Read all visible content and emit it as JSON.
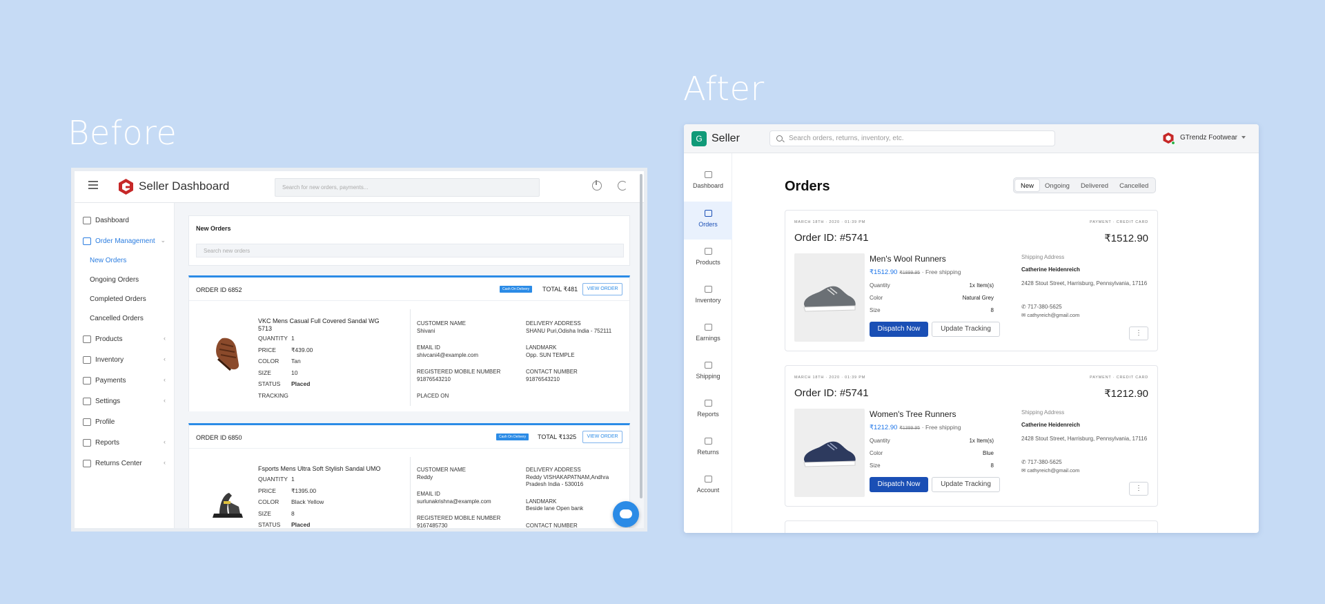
{
  "labels": {
    "before": "Before",
    "after": "After"
  },
  "before": {
    "app_title": "Seller Dashboard",
    "search_placeholder": "Search for new orders, payments...",
    "nav": [
      {
        "label": "Dashboard",
        "icon": "home-icon"
      },
      {
        "label": "Order Management",
        "icon": "cart-icon",
        "active": true
      },
      {
        "label": "Products",
        "icon": "list-icon"
      },
      {
        "label": "Inventory",
        "icon": "box-icon"
      },
      {
        "label": "Payments",
        "icon": "card-icon"
      },
      {
        "label": "Settings",
        "icon": "gear-icon"
      },
      {
        "label": "Profile",
        "icon": "user-icon"
      },
      {
        "label": "Reports",
        "icon": "clip-icon"
      },
      {
        "label": "Returns Center",
        "icon": "return-icon"
      }
    ],
    "subnav": [
      "New Orders",
      "Ongoing Orders",
      "Completed Orders",
      "Cancelled Orders"
    ],
    "new_orders_title": "New Orders",
    "new_orders_search": "Search new orders",
    "orders": [
      {
        "id": "ORDER ID 6852",
        "badge": "Cash On Delivery",
        "total": "TOTAL ₹481",
        "view": "VIEW ORDER",
        "name": "VKC Mens Casual Full Covered Sandal WG 5713",
        "quantity_k": "QUANTITY",
        "quantity": "1",
        "price_k": "PRICE",
        "price": "₹439.00",
        "color_k": "COLOR",
        "color": "Tan",
        "size_k": "SIZE",
        "size": "10",
        "status_k": "STATUS",
        "status": "Placed",
        "tracking_k": "TRACKING",
        "customer_k": "CUSTOMER NAME",
        "customer": "Shivani",
        "email_k": "EMAIL ID",
        "email": "shivcani4@example.com",
        "mobile_k": "REGISTERED MOBILE NUMBER",
        "mobile": "91876543210",
        "placed_k": "PLACED ON",
        "delivery_k": "DELIVERY ADDRESS",
        "delivery": "SHANU Puri,Odisha India - 752111",
        "landmark_k": "LANDMARK",
        "landmark": "Opp. SUN TEMPLE",
        "contact_k": "CONTACT NUMBER",
        "contact": "91876543210"
      },
      {
        "id": "ORDER ID 6850",
        "badge": "Cash On Delivery",
        "total": "TOTAL ₹1325",
        "view": "VIEW ORDER",
        "name": "Fsports Mens Ultra Soft Stylish Sandal UMO",
        "quantity_k": "QUANTITY",
        "quantity": "1",
        "price_k": "PRICE",
        "price": "₹1395.00",
        "color_k": "COLOR",
        "color": "Black Yellow",
        "size_k": "SIZE",
        "size": "8",
        "status_k": "STATUS",
        "status": "Placed",
        "customer_k": "CUSTOMER NAME",
        "customer": "Reddy",
        "email_k": "EMAIL ID",
        "email": "surlunakrishna@example.com",
        "mobile_k": "REGISTERED MOBILE NUMBER",
        "mobile": "9167485730",
        "delivery_k": "DELIVERY ADDRESS",
        "delivery": "Reddy VISHAKAPATNAM,Andhra Pradesh India - 530016",
        "landmark_k": "LANDMARK",
        "landmark": "Beside lane Open bank",
        "contact_k": "CONTACT NUMBER"
      }
    ]
  },
  "after": {
    "brand": "Seller",
    "logo_letter": "G",
    "search_placeholder": "Search orders, returns, inventory, etc.",
    "store": "GTrendz Footwear",
    "rail": [
      "Dashboard",
      "Orders",
      "Products",
      "Inventory",
      "Earnings",
      "Shipping",
      "Reports",
      "Returns",
      "Account"
    ],
    "page_title": "Orders",
    "tabs": [
      "New",
      "Ongoing",
      "Delivered",
      "Cancelled"
    ],
    "orders": [
      {
        "date": "MARCH 18TH · 2020 · 01:39 PM",
        "payment": "PAYMENT · CREDIT CARD",
        "id": "Order ID: #5741",
        "amount": "₹1512.90",
        "name": "Men's Wool Runners",
        "price": "₹1512.90",
        "mrp": "₹1899.95",
        "shipping": "· Free shipping",
        "quantity_k": "Quantity",
        "quantity": "1x Item(s)",
        "color_k": "Color",
        "color": "Natural Grey",
        "size_k": "Size",
        "size": "8",
        "dispatch": "Dispatch Now",
        "tracking": "Update Tracking",
        "addr_label": "Shipping Address",
        "addr_name": "Catherine Heidenreich",
        "addr_line": "2428 Stout Street, Harrisburg, Pennsylvania, 17116",
        "phone": "717-380-5625",
        "email": "cathyreich@gmail.com",
        "shoe_color": "#6b7075"
      },
      {
        "date": "MARCH 18TH · 2020 · 01:39 PM",
        "payment": "PAYMENT · CREDIT CARD",
        "id": "Order ID: #5741",
        "amount": "₹1212.90",
        "name": "Women's Tree Runners",
        "price": "₹1212.90",
        "mrp": "₹1399.95",
        "shipping": "· Free shipping",
        "quantity_k": "Quantity",
        "quantity": "1x Item(s)",
        "color_k": "Color",
        "color": "Blue",
        "size_k": "Size",
        "size": "8",
        "dispatch": "Dispatch Now",
        "tracking": "Update Tracking",
        "addr_label": "Shipping Address",
        "addr_name": "Catherine Heidenreich",
        "addr_line": "2428 Stout Street, Harrisburg, Pennsylvania, 17116",
        "phone": "717-380-5625",
        "email": "cathyreich@gmail.com",
        "shoe_color": "#2d3a5e"
      }
    ]
  }
}
